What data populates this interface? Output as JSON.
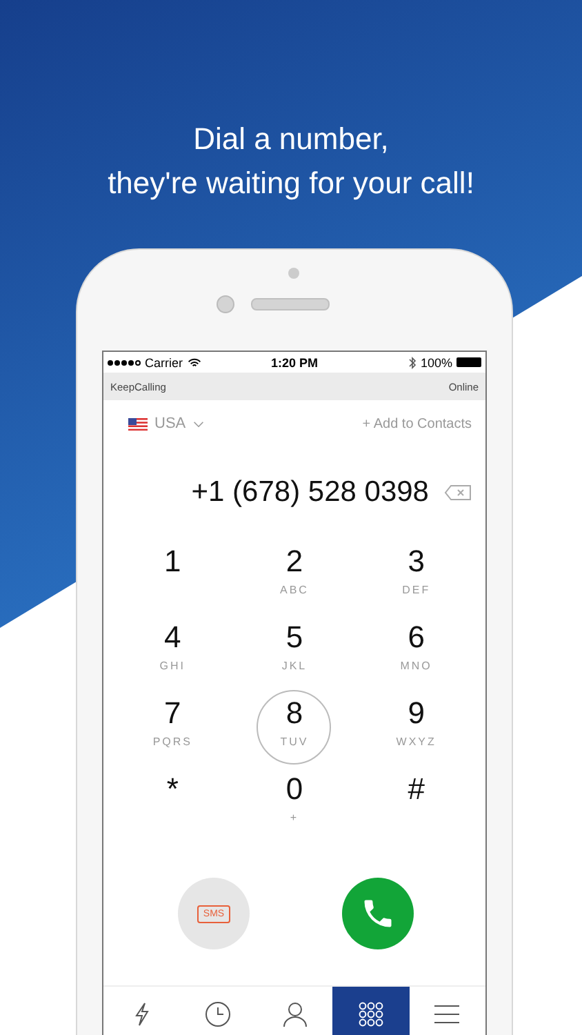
{
  "headline": [
    "Dial a number,",
    "they're waiting for your call!"
  ],
  "status_bar": {
    "carrier": "Carrier",
    "time": "1:20 PM",
    "battery": "100%"
  },
  "app_bar": {
    "title": "KeepCalling",
    "status": "Online"
  },
  "country": {
    "name": "USA"
  },
  "add_contact": "+ Add to Contacts",
  "number": "+1 (678) 528 0398",
  "keys": [
    {
      "digit": "1",
      "selected": false
    },
    {
      "digit": "2",
      "letters": "ABC",
      "selected": false
    },
    {
      "digit": "3",
      "letters": "DEF",
      "selected": false
    },
    {
      "digit": "4",
      "letters": "GHI",
      "selected": false
    },
    {
      "digit": "5",
      "letters": "JKL",
      "selected": false
    },
    {
      "digit": "6",
      "letters": "MNO",
      "selected": false
    },
    {
      "digit": "7",
      "letters": "PQRS",
      "selected": false
    },
    {
      "digit": "8",
      "letters": "TUV",
      "selected": true
    },
    {
      "digit": "9",
      "letters": "WXYZ",
      "selected": false
    },
    {
      "digit": "*",
      "selected": false
    },
    {
      "digit": "0",
      "letters": "+",
      "selected": false
    },
    {
      "digit": "#",
      "selected": false
    }
  ],
  "sms_button": "SMS",
  "tabs": [
    {
      "kind": "bolt",
      "selected": false
    },
    {
      "kind": "clock",
      "selected": false
    },
    {
      "kind": "person",
      "selected": false
    },
    {
      "kind": "keypad",
      "selected": true
    },
    {
      "kind": "menu",
      "selected": false
    }
  ]
}
